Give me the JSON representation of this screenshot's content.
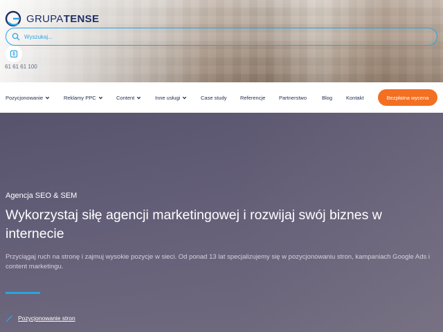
{
  "brand": {
    "name_thin": "GRUPA",
    "name_bold": "TENSE"
  },
  "search": {
    "placeholder": "Wyszukaj..."
  },
  "contact": {
    "phone": "61 61 61 100"
  },
  "nav": {
    "items": [
      {
        "label": "Pozycjonowanie",
        "dropdown": true
      },
      {
        "label": "Reklamy PPC",
        "dropdown": true
      },
      {
        "label": "Content",
        "dropdown": true
      },
      {
        "label": "Inne usługi",
        "dropdown": true
      },
      {
        "label": "Case study",
        "dropdown": false
      },
      {
        "label": "Referencje",
        "dropdown": false
      },
      {
        "label": "Partnerstwo",
        "dropdown": false
      },
      {
        "label": "Blog",
        "dropdown": false
      },
      {
        "label": "Kontakt",
        "dropdown": false
      }
    ],
    "cta_label": "Bezpłatna wycena"
  },
  "hero": {
    "eyebrow": "Agencja SEO & SEM",
    "headline": "Wykorzystaj siłę agencji marketingowej i rozwijaj swój biznes w internecie",
    "lead": "Przyciągaj ruch na stronę i zajmuj wysokie pozycje w sieci. Od ponad 13 lat specjalizujemy się w pozycjonowaniu stron, kampaniach Google Ads i content marketingu.",
    "link_label": "Pozycjonowanie stron"
  },
  "colors": {
    "brand_navy": "#1e2d63",
    "accent_blue": "#2aa4e0",
    "cta_orange": "#f36f21",
    "hero_bg": "#5f5a72"
  },
  "icons": [
    "logo-mark-icon",
    "search-icon",
    "accessibility-icon",
    "chevron-down-icon",
    "pencil-icon"
  ]
}
